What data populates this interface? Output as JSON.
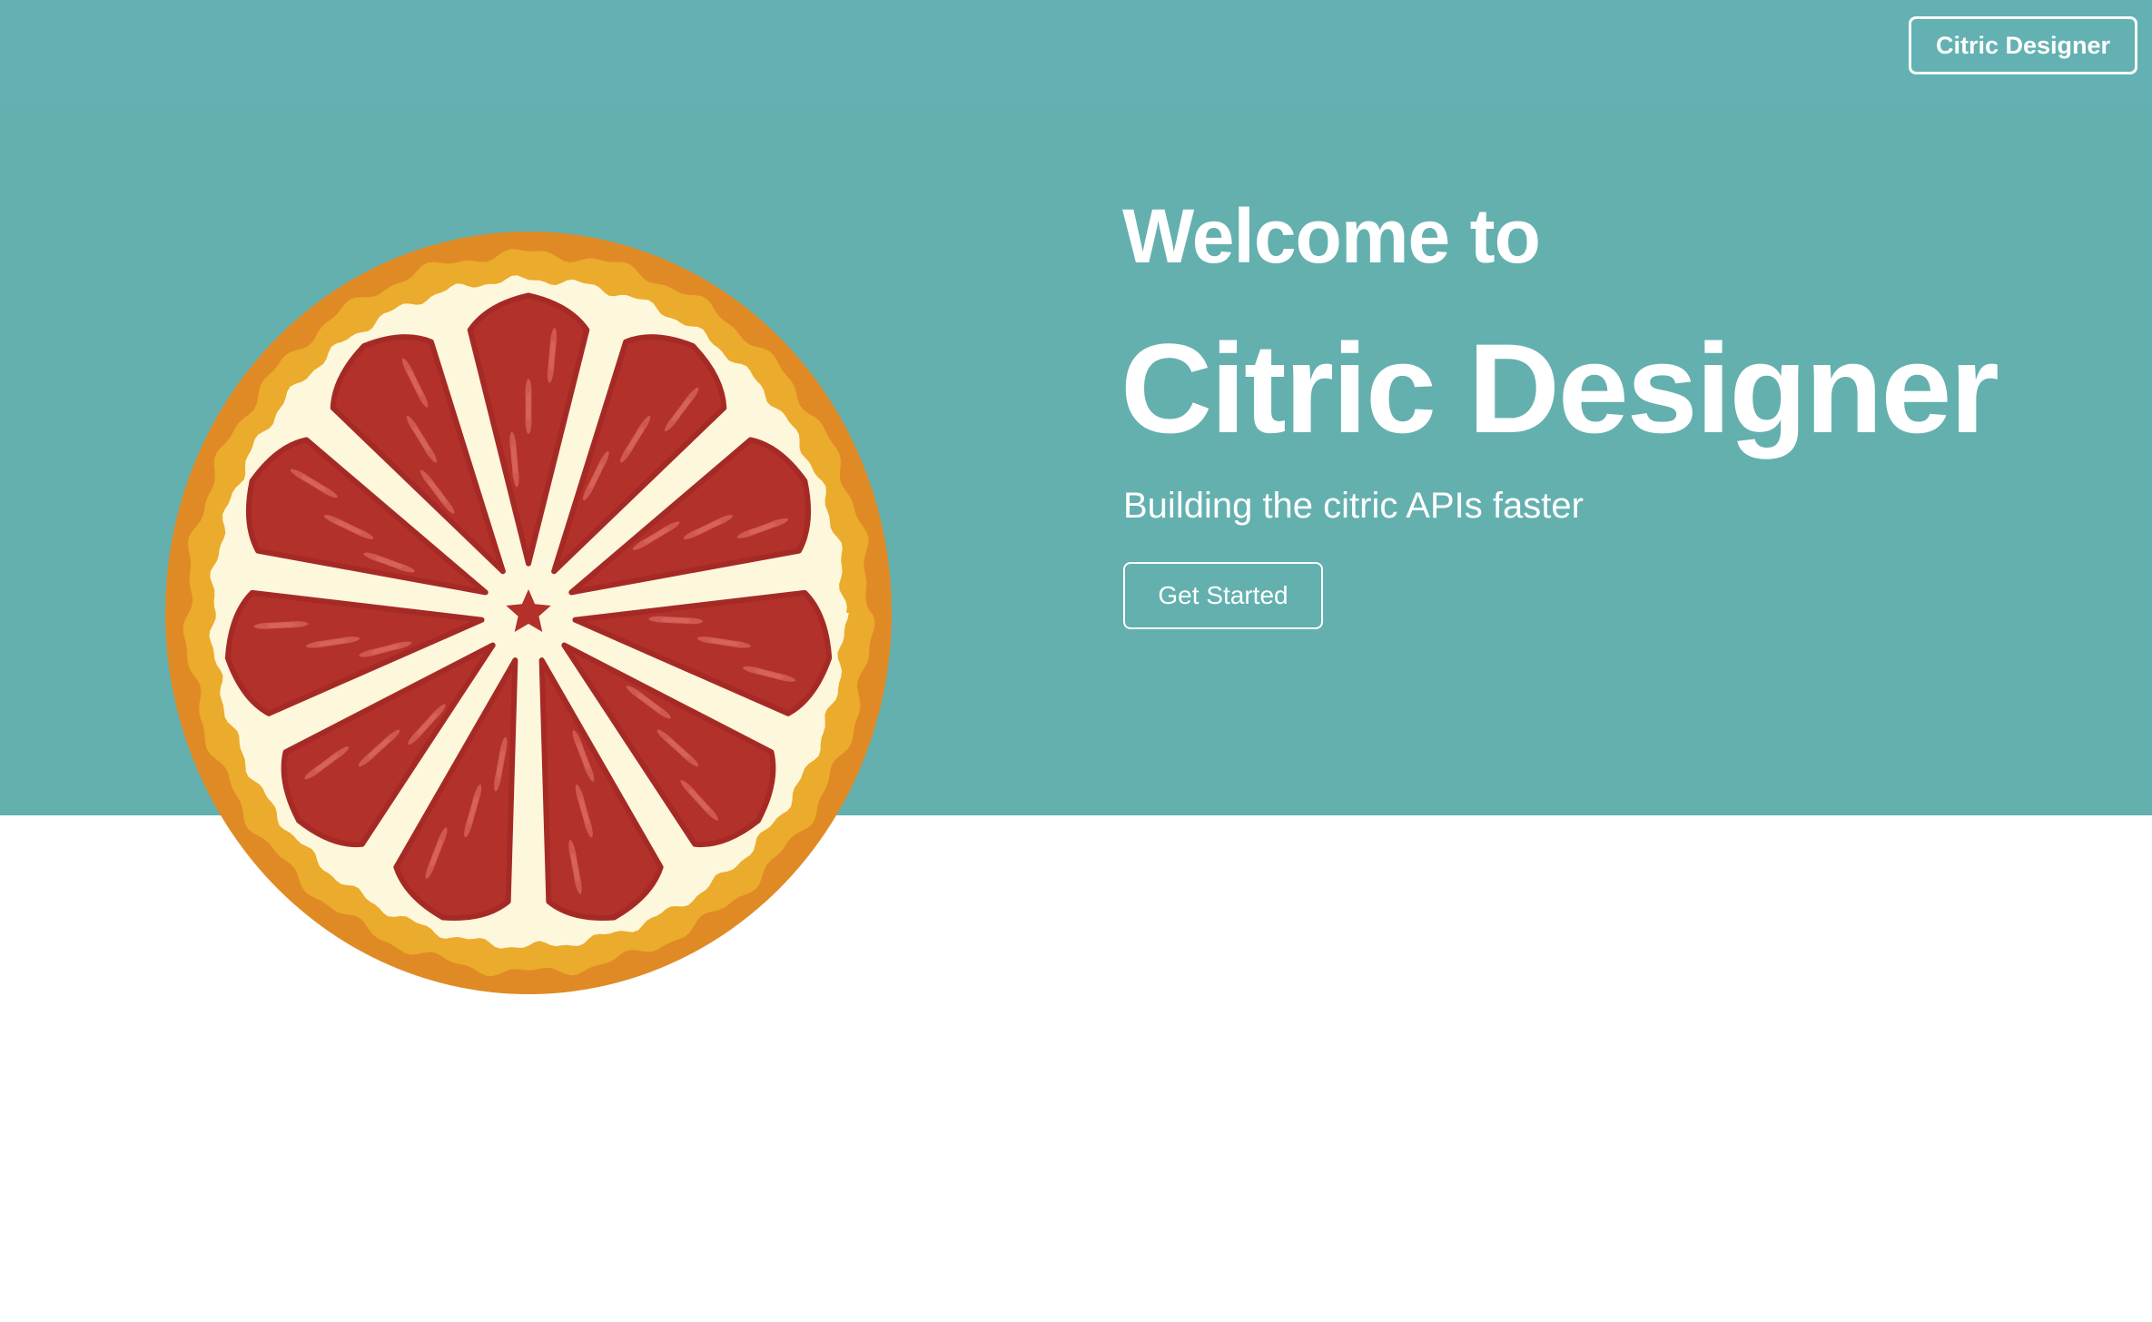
{
  "header": {
    "brand_label": "Citric Designer"
  },
  "hero": {
    "welcome": "Welcome to",
    "title": "Citric Designer",
    "subtitle": "Building the citric APIs faster",
    "cta_label": "Get Started",
    "illustration": "grapefruit-slice-icon"
  },
  "colors": {
    "hero_background": "#63b0af",
    "text": "#ffffff",
    "peel_outer": "#e08a26",
    "peel_inner": "#ebab2c",
    "pith": "#fdf7dc",
    "segment": "#b2312b",
    "segment_dark": "#a52a25",
    "vesicle": "#d8655d"
  }
}
